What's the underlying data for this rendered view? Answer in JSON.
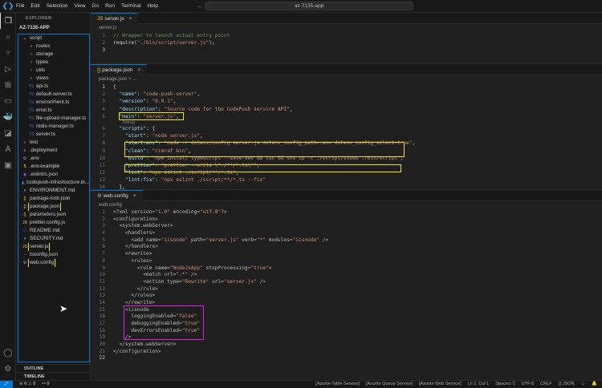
{
  "titlebar": {
    "menu": [
      "File",
      "Edit",
      "Selection",
      "View",
      "Go",
      "Run",
      "Terminal",
      "Help"
    ],
    "search": "az-7135-app"
  },
  "sidebar": {
    "header": "EXPLORER",
    "project": "AZ-7135-APP",
    "outline": "OUTLINE",
    "timeline": "TIMELINE",
    "tree": [
      {
        "label": "script",
        "indent": 1,
        "icon": "chevron-down",
        "hl": false
      },
      {
        "label": "routes",
        "indent": 2,
        "icon": "chevron-right",
        "hl": false
      },
      {
        "label": "storage",
        "indent": 2,
        "icon": "chevron-right",
        "hl": false
      },
      {
        "label": "types",
        "indent": 2,
        "icon": "chevron-right",
        "hl": false
      },
      {
        "label": "utils",
        "indent": 2,
        "icon": "chevron-right",
        "hl": false
      },
      {
        "label": "views",
        "indent": 2,
        "icon": "chevron-right",
        "hl": false
      },
      {
        "label": "api.ts",
        "indent": 2,
        "icon": "ts",
        "hl": false
      },
      {
        "label": "default-server.ts",
        "indent": 2,
        "icon": "ts",
        "hl": false
      },
      {
        "label": "environment.ts",
        "indent": 2,
        "icon": "ts",
        "hl": false
      },
      {
        "label": "error.ts",
        "indent": 2,
        "icon": "ts",
        "hl": false
      },
      {
        "label": "file-upload-manager.ts",
        "indent": 2,
        "icon": "ts",
        "hl": false
      },
      {
        "label": "redis-manager.ts",
        "indent": 2,
        "icon": "ts",
        "hl": false
      },
      {
        "label": "server.ts",
        "indent": 2,
        "icon": "ts",
        "hl": false
      },
      {
        "label": "test",
        "indent": 1,
        "icon": "chevron-right",
        "hl": false
      },
      {
        "label": ".deployment",
        "indent": 1,
        "icon": "file",
        "hl": false
      },
      {
        "label": ".env",
        "indent": 1,
        "icon": "gear",
        "hl": false
      },
      {
        "label": ".env.example",
        "indent": 1,
        "icon": "dollar",
        "hl": false
      },
      {
        "label": ".eslintrc.json",
        "indent": 1,
        "icon": "eslint",
        "hl": false
      },
      {
        "label": "codepush-infrastructure.bi...",
        "indent": 1,
        "icon": "bicep",
        "hl": false
      },
      {
        "label": "ENVIRONMENT.md",
        "indent": 1,
        "icon": "md",
        "hl": false
      },
      {
        "label": "package-lock.json",
        "indent": 1,
        "icon": "json",
        "hl": false
      },
      {
        "label": "package.json",
        "indent": 1,
        "icon": "json",
        "hl": true
      },
      {
        "label": "parameters.json",
        "indent": 1,
        "icon": "json",
        "hl": false
      },
      {
        "label": "prettier.config.js",
        "indent": 1,
        "icon": "js",
        "hl": false
      },
      {
        "label": "README.md",
        "indent": 1,
        "icon": "info",
        "hl": false
      },
      {
        "label": "SECURITY.md",
        "indent": 1,
        "icon": "md",
        "hl": false
      },
      {
        "label": "server.js",
        "indent": 1,
        "icon": "js",
        "hl": true
      },
      {
        "label": "tsconfig.json",
        "indent": 1,
        "icon": "tsconfig",
        "hl": false
      },
      {
        "label": "web.config",
        "indent": 1,
        "icon": "gear",
        "hl": true
      }
    ]
  },
  "editors": {
    "server": {
      "tab": "server.js",
      "crumb": "server.js",
      "lines": [
        "// Wrapper to launch actual entry point",
        "require(\"./bin/script/server.js\");",
        ""
      ]
    },
    "package": {
      "tab": "package.json",
      "crumb": "package.json > ...",
      "codelens": "Debug",
      "lines": [
        "{",
        "  \"name\": \"code-push-server\",",
        "  \"version\": \"0.0.1\",",
        "  \"description\": \"Source code for the CodePush service API\",",
        "  \"main\": \"server.js\",",
        "  \"scripts\": {",
        "    \"start\": \"node server.js\",",
        "    \"start:env\": \"node -r dotenv/config server.js dotenv_config_path=.env dotenv_config_silent=true\",",
        "    \"clean\": \"rimraf bin\",",
        "    \"build\": \"npm install typescript --save-dev && tsc && shx cp -r ./script/views ./bin/script\",",
        "    \"prettier\": \"prettier --write \\\"./**/*.ts\\\"\",",
        "    \"lint\": \"npx eslint ./script/**/*.ts\",",
        "    \"lint:fix\": \"npx eslint ./script/**/*.ts --fix\"",
        "  },"
      ]
    },
    "web": {
      "tab": "web.config",
      "crumb": "web.config",
      "lines": [
        "<?xml version=\"1.0\" encoding=\"utf-8\"?>",
        "<configuration>",
        "  <system.webServer>",
        "    <handlers>",
        "      <add name=\"iisnode\" path=\"server.js\" verb=\"*\" modules=\"iisnode\" />",
        "    </handlers>",
        "    <rewrite>",
        "      <rules>",
        "        <rule name=\"NodeJsApp\" stopProcessing=\"true\">",
        "          <match url=\".*\" />",
        "          <action type=\"Rewrite\" url=\"server.js\" />",
        "        </rule>",
        "      </rules>",
        "    </rewrite>",
        "    <iisnode",
        "      loggingEnabled=\"false\"",
        "      debuggingEnabled=\"true\"",
        "      devErrorsEnabled=\"true\"",
        "    />",
        "  </system.webServer>",
        "</configuration>",
        ""
      ]
    }
  },
  "status": {
    "errors": "0",
    "warnings": "0",
    "ports": "0",
    "items": [
      "[Azurite Table Service]",
      "[Azurite Queue Service]",
      "[Azurite Blob Service]",
      "Ln 1, Col 1",
      "Spaces: 2",
      "UTF-8",
      "CRLF",
      "{} JSON"
    ]
  },
  "colors": {
    "highlight": "#f2e500",
    "highlight2": "#e020e0",
    "accent": "#0078d4"
  }
}
